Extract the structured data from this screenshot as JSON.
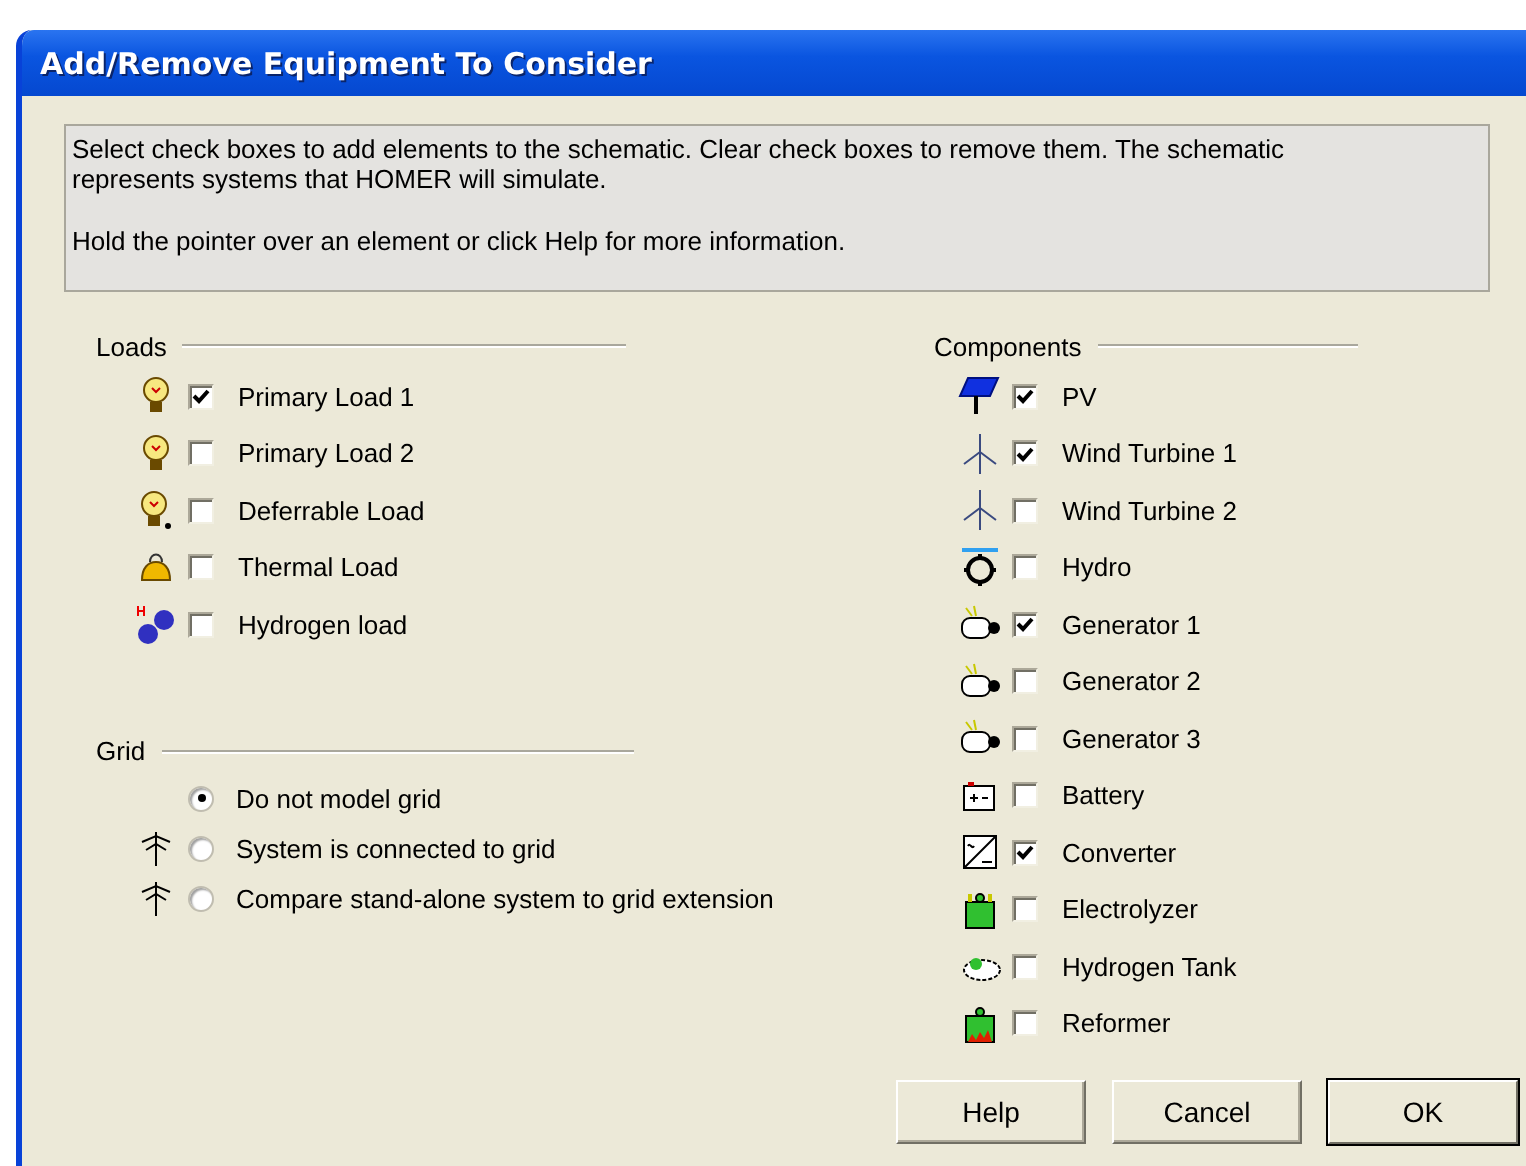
{
  "window": {
    "title": "Add/Remove Equipment To Consider"
  },
  "info": {
    "lines": [
      "Select check boxes to add elements to the schematic. Clear check boxes to remove them. The schematic represents systems that HOMER will simulate.",
      "Hold the pointer over an element or click Help for more information."
    ]
  },
  "loads": {
    "title": "Loads",
    "items": [
      {
        "kind": "bulb",
        "label": "Primary Load 1",
        "checked": true
      },
      {
        "kind": "bulb",
        "label": "Primary Load 2",
        "checked": false
      },
      {
        "kind": "bulb-deferred",
        "label": "Deferrable Load",
        "checked": false
      },
      {
        "kind": "kettle",
        "label": "Thermal Load",
        "checked": false
      },
      {
        "kind": "molecule",
        "label": "Hydrogen load",
        "checked": false
      }
    ]
  },
  "grid": {
    "title": "Grid",
    "options": [
      {
        "kind": "plain",
        "label": "Do not model grid",
        "selected": true
      },
      {
        "kind": "pylon",
        "label": "System is connected to grid",
        "selected": false
      },
      {
        "kind": "pylon",
        "label": "Compare stand-alone system to grid extension",
        "selected": false
      }
    ]
  },
  "components": {
    "title": "Components",
    "items": [
      {
        "kind": "solar",
        "label": "PV",
        "checked": true
      },
      {
        "kind": "turbine",
        "label": "Wind Turbine 1",
        "checked": true
      },
      {
        "kind": "turbine",
        "label": "Wind Turbine 2",
        "checked": false
      },
      {
        "kind": "hydro",
        "label": "Hydro",
        "checked": false
      },
      {
        "kind": "generator",
        "label": "Generator 1",
        "checked": true
      },
      {
        "kind": "generator",
        "label": "Generator 2",
        "checked": false
      },
      {
        "kind": "generator",
        "label": "Generator 3",
        "checked": false
      },
      {
        "kind": "battery",
        "label": "Battery",
        "checked": false
      },
      {
        "kind": "converter",
        "label": "Converter",
        "checked": true
      },
      {
        "kind": "electrolyzer",
        "label": "Electrolyzer",
        "checked": false
      },
      {
        "kind": "tank",
        "label": "Hydrogen Tank",
        "checked": false
      },
      {
        "kind": "reformer",
        "label": "Reformer",
        "checked": false
      }
    ]
  },
  "buttons": [
    {
      "kind": "normal",
      "label": "Help"
    },
    {
      "kind": "normal",
      "label": "Cancel"
    },
    {
      "kind": "default",
      "label": "OK"
    }
  ]
}
